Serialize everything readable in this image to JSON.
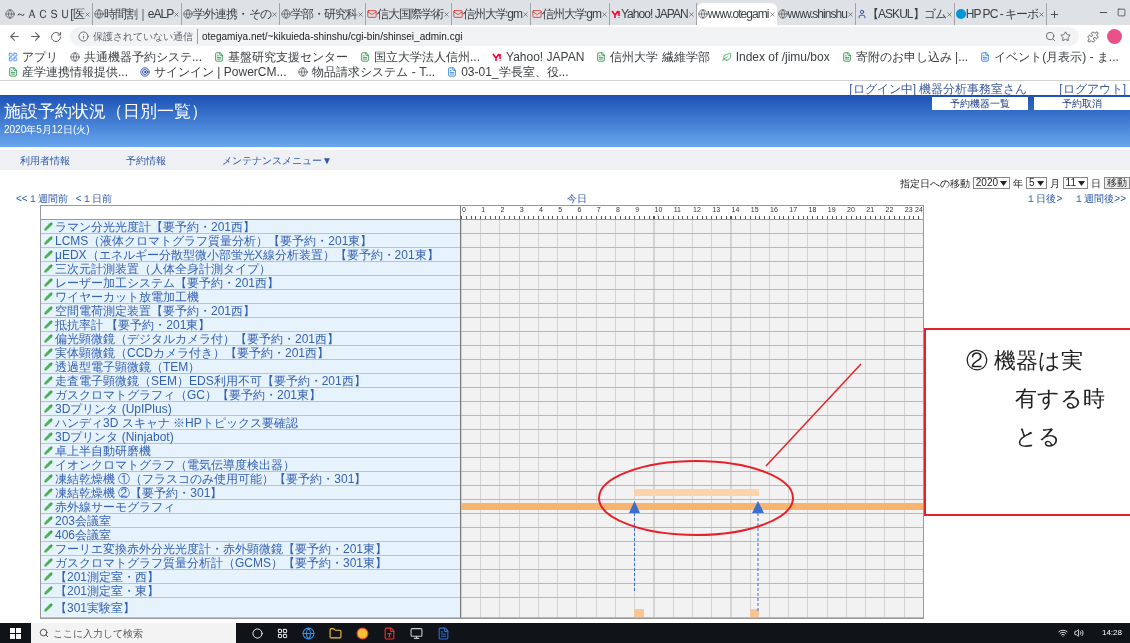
{
  "browser": {
    "tabs": [
      {
        "title": "～ＡＣＳＵ[医",
        "kind": "globe",
        "selected": false
      },
      {
        "title": "時間割｜eALP",
        "kind": "globe",
        "selected": false
      },
      {
        "title": "学外連携・その",
        "kind": "globe",
        "selected": false
      },
      {
        "title": "学部・研究科",
        "kind": "globe",
        "selected": false
      },
      {
        "title": "信大国際学術",
        "kind": "mail",
        "selected": false
      },
      {
        "title": "信州大学gm",
        "kind": "mail",
        "selected": false
      },
      {
        "title": "信州大学gm",
        "kind": "mail",
        "selected": false
      },
      {
        "title": "Yahoo! JAPAN",
        "kind": "yahoo",
        "selected": false
      },
      {
        "title": "www.otegami",
        "kind": "globe",
        "selected": true
      },
      {
        "title": "www.shinshu",
        "kind": "globe",
        "selected": false
      },
      {
        "title": "【ASKUL】ゴム",
        "kind": "person",
        "selected": false
      },
      {
        "title": "HP PC - キーボ",
        "kind": "hp",
        "selected": false
      }
    ],
    "security": "保護されていない通信",
    "url": "otegamiya.net/~kikuieda-shinshu/cgi-bin/shinsei_admin.cgi",
    "bookmarks": [
      {
        "label": "アプリ",
        "kind": "grid"
      },
      {
        "label": "共通機器予約システ...",
        "kind": "globe"
      },
      {
        "label": "基盤研究支援センター",
        "kind": "sheet"
      },
      {
        "label": "国立大学法人信州...",
        "kind": "sheet"
      },
      {
        "label": "Yahoo! JAPAN",
        "kind": "yahoo"
      },
      {
        "label": "信州大学 繊維学部",
        "kind": "sheet"
      },
      {
        "label": "Index of /jimu/box",
        "kind": "leaf"
      },
      {
        "label": "寄附のお申し込み |...",
        "kind": "sheet"
      },
      {
        "label": "イベント(月表示) - ま...",
        "kind": "page"
      },
      {
        "label": "産学連携情報提供...",
        "kind": "sheet"
      },
      {
        "label": "サインイン | PowerCM...",
        "kind": "target"
      },
      {
        "label": "物品請求システム - T...",
        "kind": "globe"
      },
      {
        "label": "03-01_学長室、役...",
        "kind": "page"
      }
    ]
  },
  "header": {
    "login_status": "[ログイン中]",
    "user": "機器分析事務室さん",
    "logout": "[ログアウト]",
    "title": "施設予約状況（日別一覧）",
    "date": "2020年5月12日(火)",
    "buttons": [
      "予約機器一覧",
      "予約取消"
    ]
  },
  "nav": [
    "利用者情報",
    "予約情報",
    "メンテナンスメニュー▼"
  ],
  "date_jump": {
    "label": "指定日への移動",
    "year": "2020",
    "year_unit": "年",
    "month": "5",
    "month_unit": "月",
    "day": "11",
    "day_unit": "日",
    "button": "移動"
  },
  "schedule": {
    "prev_week": "<<１週間前",
    "prev_day": "<１日前",
    "today": "今日",
    "next_day": "１日後>",
    "next_week": "１週間後>>",
    "hours": [
      "0",
      "1",
      "2",
      "3",
      "4",
      "5",
      "6",
      "7",
      "8",
      "9",
      "10",
      "11",
      "12",
      "13",
      "14",
      "15",
      "16",
      "17",
      "18",
      "19",
      "20",
      "21",
      "22",
      "23",
      "24"
    ],
    "rows": [
      {
        "name": "ラマン分光光度計【要予約・201西】"
      },
      {
        "name": "LCMS（液体クロマトグラフ質量分析）【要予約・201東】"
      },
      {
        "name": "μEDX（エネルギー分散型微小部蛍光X線分析装置）【要予約・201東】"
      },
      {
        "name": "三次元計測装置（人体全身計測タイプ）"
      },
      {
        "name": "レーザー加工システム【要予約・201西】"
      },
      {
        "name": "ワイヤーカット放電加工機"
      },
      {
        "name": "空間電荷測定装置【要予約・201西】"
      },
      {
        "name": "抵抗率計 【要予約・201東】"
      },
      {
        "name": "偏光顕微鏡（デジタルカメラ付）【要予約・201西】"
      },
      {
        "name": "実体顕微鏡（CCDカメラ付き）【要予約・201西】"
      },
      {
        "name": "透過型電子顕微鏡（TEM）"
      },
      {
        "name": "走査電子顕微鏡（SEM）EDS利用不可【要予約・201西】"
      },
      {
        "name": "ガスクロマトグラフィ（GC）【要予約・201東】"
      },
      {
        "name": "3Dプリンタ (UpIPlus)"
      },
      {
        "name": "ハンディ3D スキャナ ※HPトピックス要確認"
      },
      {
        "name": "3Dプリンタ (Ninjabot)"
      },
      {
        "name": "卓上半自動研磨機"
      },
      {
        "name": "イオンクロマトグラフ（電気伝導度検出器）"
      },
      {
        "name": "凍結乾燥機 ①（フラスコのみ使用可能）【要予約・301】"
      },
      {
        "name": "凍結乾燥機 ②【要予約・301】",
        "kind": "bar",
        "color": "#fcd3aa",
        "slots": [
          false,
          false,
          false,
          false,
          false,
          false,
          false,
          false,
          false,
          false,
          false,
          false,
          false,
          false,
          false,
          false,
          false,
          false,
          true,
          true,
          true,
          true,
          true,
          true,
          true,
          true,
          true,
          true,
          true,
          true,
          true,
          false,
          false,
          false,
          false,
          false,
          false,
          false,
          false,
          false,
          false,
          false,
          false,
          false,
          false,
          false,
          false,
          false
        ]
      },
      {
        "name": "赤外線サーモグラフィ",
        "kind": "bar",
        "color": "#f7b46e",
        "slots": [
          true,
          true,
          true,
          true,
          true,
          true,
          true,
          true,
          true,
          true,
          true,
          true,
          true,
          true,
          true,
          true,
          true,
          true,
          true,
          true,
          true,
          true,
          true,
          true,
          true,
          true,
          true,
          true,
          true,
          true,
          true,
          true,
          true,
          true,
          true,
          true,
          true,
          true,
          true,
          true,
          true,
          true,
          true,
          true,
          true,
          true,
          true,
          true
        ]
      },
      {
        "name": "203会議室"
      },
      {
        "name": "406会議室"
      },
      {
        "name": "フーリエ変換赤外分光光度計・赤外顕微鏡【要予約・201東】"
      },
      {
        "name": "ガスクロマトグラフ質量分析計（GCMS）【要予約・301東】"
      },
      {
        "name": "【201測定室・西】"
      },
      {
        "name": "【201測定室・東】"
      },
      {
        "name": "【301実験室】",
        "kind": "mark",
        "color": "#f9c594",
        "slots": [
          false,
          false,
          false,
          false,
          false,
          false,
          false,
          false,
          false,
          false,
          false,
          false,
          false,
          false,
          false,
          false,
          false,
          false,
          true,
          false,
          false,
          false,
          false,
          false,
          false,
          false,
          false,
          false,
          false,
          false,
          true,
          false,
          false,
          false,
          false,
          false,
          false,
          false,
          false,
          false,
          false,
          false,
          false,
          false,
          false,
          false,
          false,
          false
        ]
      }
    ]
  },
  "callout": {
    "lines": [
      "② 機器は実",
      "有する時",
      "とる"
    ]
  },
  "taskbar": {
    "search_placeholder": "ここに入力して検索",
    "time": "14:28"
  }
}
